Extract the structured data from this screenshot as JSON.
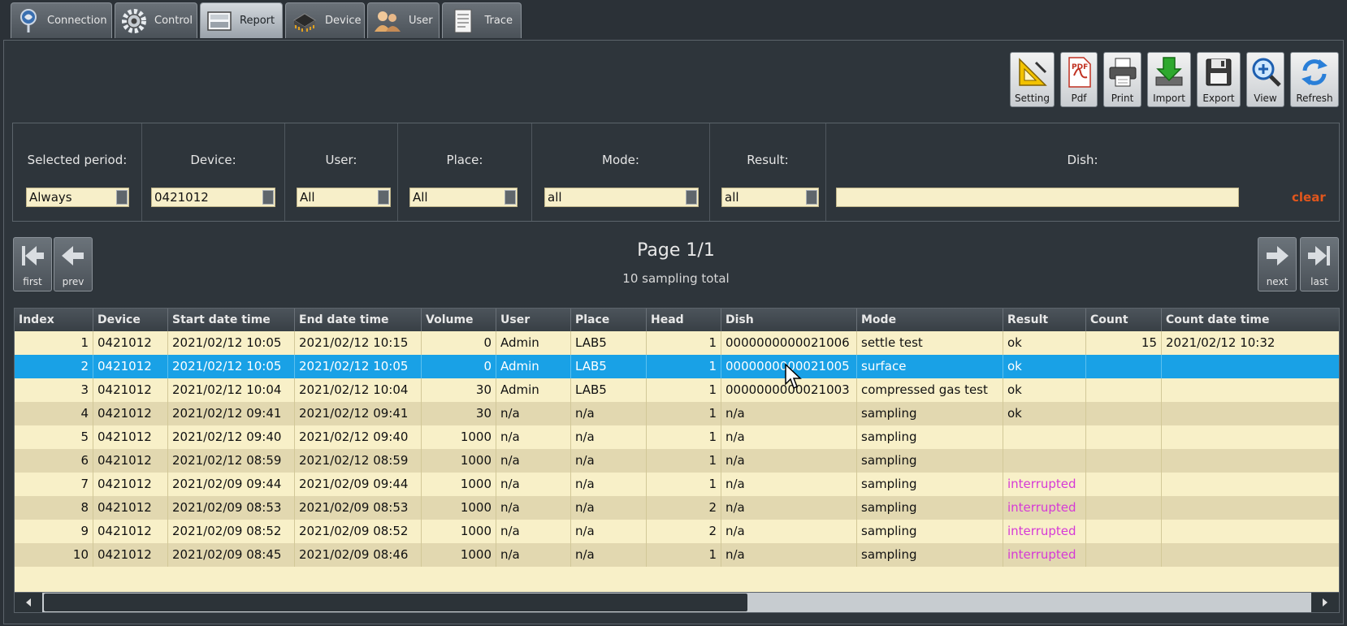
{
  "tabs": [
    {
      "label": "Connection",
      "icon": "connection-icon",
      "active": false
    },
    {
      "label": "Control",
      "icon": "gear-icon",
      "active": false
    },
    {
      "label": "Report",
      "icon": "report-icon",
      "active": true
    },
    {
      "label": "Device",
      "icon": "device-icon",
      "active": false
    },
    {
      "label": "User",
      "icon": "users-icon",
      "active": false
    },
    {
      "label": "Trace",
      "icon": "document-icon",
      "active": false
    }
  ],
  "toolbar": {
    "setting": "Setting",
    "pdf": "Pdf",
    "pdf_badge": "PDF",
    "print": "Print",
    "import": "Import",
    "export": "Export",
    "view": "View",
    "refresh": "Refresh"
  },
  "filters": {
    "period": {
      "label": "Selected period:",
      "value": "Always"
    },
    "device": {
      "label": "Device:",
      "value": "0421012"
    },
    "user": {
      "label": "User:",
      "value": "All"
    },
    "place": {
      "label": "Place:",
      "value": "All"
    },
    "mode": {
      "label": "Mode:",
      "value": "all"
    },
    "result": {
      "label": "Result:",
      "value": "all"
    },
    "dish": {
      "label": "Dish:",
      "value": "",
      "clear": "clear"
    }
  },
  "pager": {
    "first": "first",
    "prev": "prev",
    "next": "next",
    "last": "last",
    "page": "Page 1/1",
    "total": "10 sampling total"
  },
  "table": {
    "columns": [
      "Index",
      "Device",
      "Start date time",
      "End date time",
      "Volume",
      "User",
      "Place",
      "Head",
      "Dish",
      "Mode",
      "Result",
      "Count",
      "Count date time"
    ],
    "selected_row": 1,
    "rows": [
      [
        "1",
        "0421012",
        "2021/02/12 10:05",
        "2021/02/12 10:15",
        "0",
        "Admin",
        "LAB5",
        "1",
        "0000000000021006",
        "settle test",
        "ok",
        "15",
        "2021/02/12 10:32"
      ],
      [
        "2",
        "0421012",
        "2021/02/12 10:05",
        "2021/02/12 10:05",
        "0",
        "Admin",
        "LAB5",
        "1",
        "0000000000021005",
        "surface",
        "ok",
        "",
        ""
      ],
      [
        "3",
        "0421012",
        "2021/02/12 10:04",
        "2021/02/12 10:04",
        "30",
        "Admin",
        "LAB5",
        "1",
        "0000000000021003",
        "compressed gas test",
        "ok",
        "",
        ""
      ],
      [
        "4",
        "0421012",
        "2021/02/12 09:41",
        "2021/02/12 09:41",
        "30",
        "n/a",
        "n/a",
        "1",
        "n/a",
        "sampling",
        "ok",
        "",
        ""
      ],
      [
        "5",
        "0421012",
        "2021/02/12 09:40",
        "2021/02/12 09:40",
        "1000",
        "n/a",
        "n/a",
        "1",
        "n/a",
        "sampling",
        "",
        "",
        ""
      ],
      [
        "6",
        "0421012",
        "2021/02/12 08:59",
        "2021/02/12 08:59",
        "1000",
        "n/a",
        "n/a",
        "1",
        "n/a",
        "sampling",
        "",
        "",
        ""
      ],
      [
        "7",
        "0421012",
        "2021/02/09 09:44",
        "2021/02/09 09:44",
        "1000",
        "n/a",
        "n/a",
        "1",
        "n/a",
        "sampling",
        "interrupted",
        "",
        ""
      ],
      [
        "8",
        "0421012",
        "2021/02/09 08:53",
        "2021/02/09 08:53",
        "1000",
        "n/a",
        "n/a",
        "2",
        "n/a",
        "sampling",
        "interrupted",
        "",
        ""
      ],
      [
        "9",
        "0421012",
        "2021/02/09 08:52",
        "2021/02/09 08:52",
        "1000",
        "n/a",
        "n/a",
        "2",
        "n/a",
        "sampling",
        "interrupted",
        "",
        ""
      ],
      [
        "10",
        "0421012",
        "2021/02/09 08:45",
        "2021/02/09 08:46",
        "1000",
        "n/a",
        "n/a",
        "1",
        "n/a",
        "sampling",
        "interrupted",
        "",
        ""
      ]
    ]
  },
  "colors": {
    "selected_row": "#19a1e6",
    "interrupted": "#d63ad6",
    "clear_link": "#e2561c",
    "row_light": "#f8f0c8",
    "row_dark": "#e2d8b0"
  }
}
